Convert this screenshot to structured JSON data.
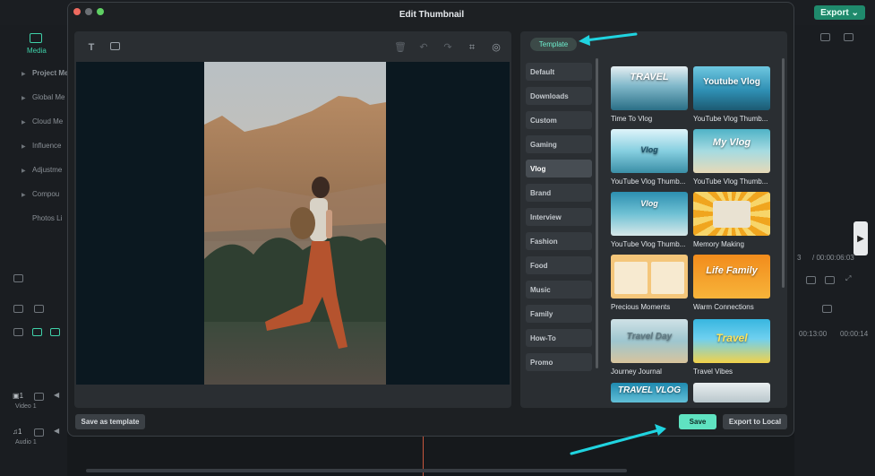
{
  "app": {
    "export_label": "Export",
    "media_tab": "Media",
    "left_panel_items": [
      "Project Me",
      "Global Me",
      "Cloud Me",
      "Influence",
      "Adjustme",
      "Compou",
      "Photos Li"
    ],
    "timecodes": [
      "3",
      "00:00:06:03"
    ],
    "timeline_times": [
      "00:13:00",
      "00:00:14"
    ],
    "tracks": [
      {
        "label": "Video 1",
        "num": "1"
      },
      {
        "label": "Audio 1",
        "num": "1"
      }
    ]
  },
  "dialog": {
    "title": "Edit Thumbnail",
    "save_as_template": "Save as template",
    "save": "Save",
    "export_to_local": "Export to Local"
  },
  "templates": {
    "tab_label": "Template",
    "categories": [
      "Default",
      "Downloads",
      "Custom",
      "Gaming",
      "Vlog",
      "Brand",
      "Interview",
      "Fashion",
      "Food",
      "Music",
      "Family",
      "How-To",
      "Promo"
    ],
    "active_category": "Vlog",
    "items": [
      {
        "name": "Time To Vlog",
        "art": "TRAVEL"
      },
      {
        "name": "YouTube Vlog Thumb...",
        "art": "Youtube Vlog"
      },
      {
        "name": "YouTube Vlog Thumb...",
        "art": "Vlog"
      },
      {
        "name": "YouTube Vlog Thumb...",
        "art": "My Vlog"
      },
      {
        "name": "YouTube Vlog Thumb...",
        "art": "Vlog"
      },
      {
        "name": "Memory Making",
        "art": ""
      },
      {
        "name": "Precious Moments",
        "art": ""
      },
      {
        "name": "Warm Connections",
        "art": "Life Family"
      },
      {
        "name": "Journey Journal",
        "art": "Travel Day"
      },
      {
        "name": "Travel Vibes",
        "art": "Travel"
      },
      {
        "name": "",
        "art": "TRAVEL VLOG"
      },
      {
        "name": "",
        "art": ""
      }
    ]
  },
  "colors": {
    "accent": "#5fe3c1",
    "arrow": "#20d4e0",
    "export_green": "#1f8a6c"
  }
}
